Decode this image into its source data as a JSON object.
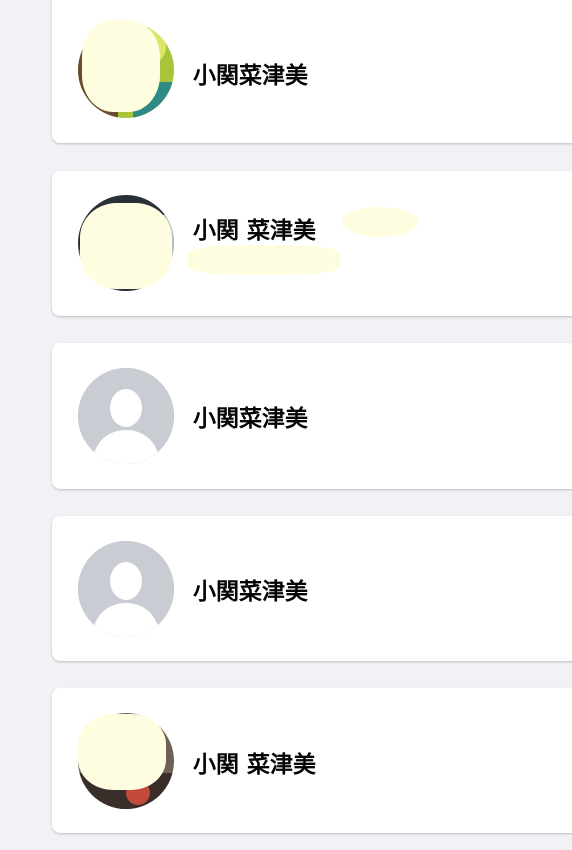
{
  "colors": {
    "page_background": "#f0f2f5",
    "card_background": "#ffffff",
    "name_text": "#050505",
    "secondary_text": "#65676b",
    "placeholder_avatar": "#c8ccd2",
    "redaction": "#fffde0"
  },
  "results": [
    {
      "name": "小関菜津美",
      "avatar": "photo-avatar-icon"
    },
    {
      "name": "小関 菜津美",
      "subtext": "",
      "avatar": "photo-avatar-icon"
    },
    {
      "name": "小関菜津美",
      "avatar": "default-person-avatar-icon"
    },
    {
      "name": "小関菜津美",
      "avatar": "default-person-avatar-icon"
    },
    {
      "name": "小関 菜津美",
      "avatar": "photo-avatar-icon"
    }
  ]
}
